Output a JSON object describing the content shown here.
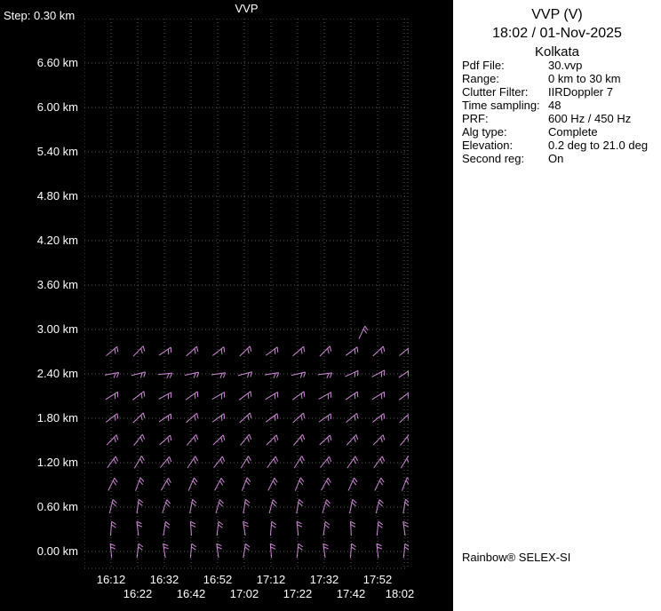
{
  "chart_data": {
    "type": "scatter",
    "marker": "wind_barb",
    "title": "VVP",
    "step_label": "Step: 0.30 km",
    "ylabel_unit": "km",
    "y_tick_labels": [
      "6.60 km",
      "6.00 km",
      "5.40 km",
      "4.80 km",
      "4.20 km",
      "3.60 km",
      "3.00 km",
      "2.40 km",
      "1.80 km",
      "1.20 km",
      "0.60 km",
      "0.00 km"
    ],
    "y_range_km": [
      0.0,
      7.2
    ],
    "height_step_km": 0.3,
    "grid": "dotted",
    "times": [
      "16:12",
      "16:22",
      "16:32",
      "16:42",
      "16:52",
      "17:02",
      "17:12",
      "17:22",
      "17:32",
      "17:42",
      "17:52",
      "18:02"
    ],
    "x_ticks_row1": [
      "16:12",
      "16:32",
      "16:52",
      "17:12",
      "17:32",
      "17:52"
    ],
    "x_ticks_row2": [
      "16:22",
      "16:42",
      "17:02",
      "17:22",
      "17:42",
      "18:02"
    ],
    "barb_color": "#d08ad8",
    "rows": [
      {
        "height_km": 2.7,
        "ticks": 2,
        "angles": [
          50,
          44,
          56,
          48,
          52,
          46,
          54,
          49,
          45,
          53,
          47,
          51
        ]
      },
      {
        "height_km": 2.4,
        "ticks": 2,
        "angles": [
          80,
          76,
          84,
          78,
          82,
          75,
          81,
          77,
          83,
          65,
          62,
          57
        ]
      },
      {
        "height_km": 2.1,
        "ticks": 2,
        "angles": [
          58,
          52,
          62,
          55,
          60,
          53,
          59,
          54,
          61,
          56,
          58,
          53
        ]
      },
      {
        "height_km": 1.8,
        "ticks": 2,
        "angles": [
          52,
          46,
          56,
          49,
          54,
          47,
          53,
          48,
          55,
          50,
          52,
          47
        ]
      },
      {
        "height_km": 1.5,
        "ticks": 2,
        "angles": [
          44,
          38,
          48,
          41,
          46,
          39,
          45,
          40,
          47,
          42,
          44,
          39
        ]
      },
      {
        "height_km": 1.2,
        "ticks": 2,
        "angles": [
          36,
          30,
          40,
          33,
          38,
          31,
          37,
          32,
          39,
          34,
          36,
          31
        ]
      },
      {
        "height_km": 0.9,
        "ticks": 2,
        "angles": [
          26,
          20,
          30,
          23,
          28,
          21,
          27,
          22,
          29,
          24,
          26,
          21
        ]
      },
      {
        "height_km": 0.6,
        "ticks": 2,
        "angles": [
          14,
          8,
          18,
          11,
          16,
          9,
          15,
          10,
          17,
          12,
          14,
          9
        ]
      },
      {
        "height_km": 0.3,
        "ticks": 2,
        "angles": [
          4,
          -7,
          9,
          -4,
          7,
          -9,
          5,
          -6,
          8,
          -3,
          6,
          -8
        ]
      },
      {
        "height_km": 0.0,
        "ticks": 2,
        "angles": [
          -6,
          7,
          -9,
          5,
          -8,
          9,
          -5,
          6,
          -8,
          4,
          -7,
          6
        ]
      }
    ],
    "extra_barbs": [
      {
        "height_km": 2.95,
        "time_index": 9.4,
        "angle": 25,
        "ticks": 2
      }
    ]
  },
  "panel": {
    "title": "VVP (V)",
    "datetime": "18:02 / 01-Nov-2025",
    "site": "Kolkata",
    "params": [
      {
        "label": "Pdf File:",
        "value": "30.vvp"
      },
      {
        "label": "Range:",
        "value": "0 km to 30 km"
      },
      {
        "label": "Clutter Filter:",
        "value": "IIRDoppler 7"
      },
      {
        "label": "Time sampling:",
        "value": "48"
      },
      {
        "label": "PRF:",
        "value": "600 Hz / 450 Hz"
      },
      {
        "label": "Alg type:",
        "value": "Complete"
      },
      {
        "label": "Elevation:",
        "value": "0.2 deg to 21.0 deg"
      },
      {
        "label": "Second reg:",
        "value": "On"
      }
    ],
    "brand": "Rainbow® SELEX-SI"
  }
}
